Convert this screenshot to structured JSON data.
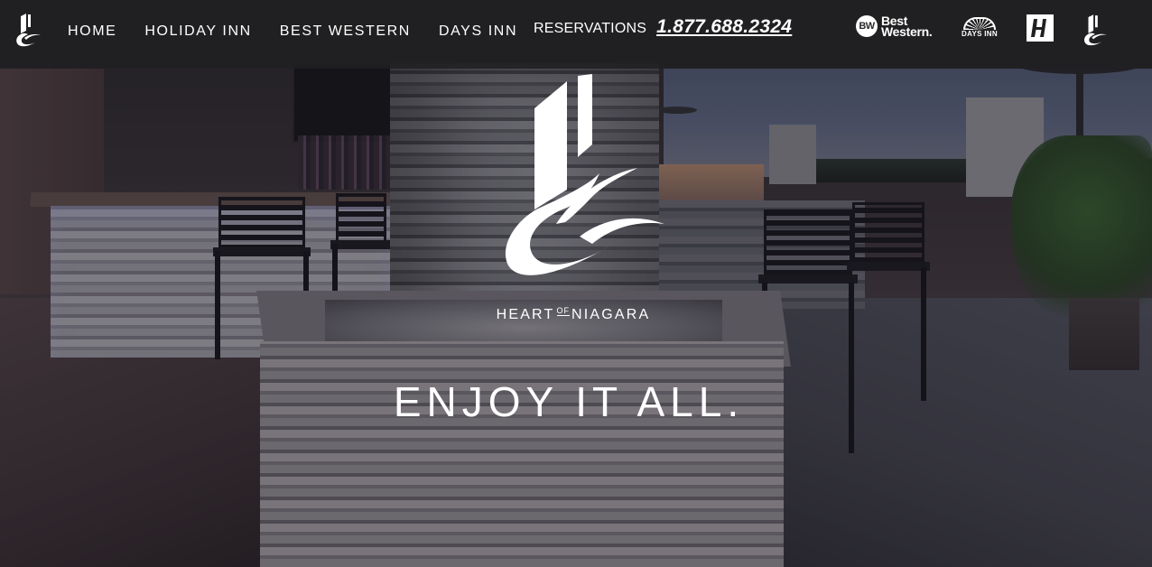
{
  "site": {
    "brand_logo_icon": "heart-of-niagara-mark-icon"
  },
  "navbar": {
    "links": [
      {
        "label": "HOME"
      },
      {
        "label": "HOLIDAY INN"
      },
      {
        "label": "BEST WESTERN"
      },
      {
        "label": "DAYS INN"
      }
    ],
    "reservations_label": "RESERVATIONS",
    "reservations_phone": "1.877.688.2324",
    "partner_logos": {
      "best_western_badge": "BW",
      "best_western_line1": "Best",
      "best_western_line2": "Western.",
      "days_inn": "DAYS INN",
      "holiday_inn_icon": "holiday-inn-h-icon",
      "heart_of_niagara_icon": "heart-of-niagara-mark-icon"
    }
  },
  "hero": {
    "wordmark_left": "HEART",
    "wordmark_of": "OF",
    "wordmark_right": "NIAGARA",
    "tagline": "ENJOY IT ALL."
  },
  "colors": {
    "nav_background": "#202022",
    "text": "#ffffff"
  }
}
